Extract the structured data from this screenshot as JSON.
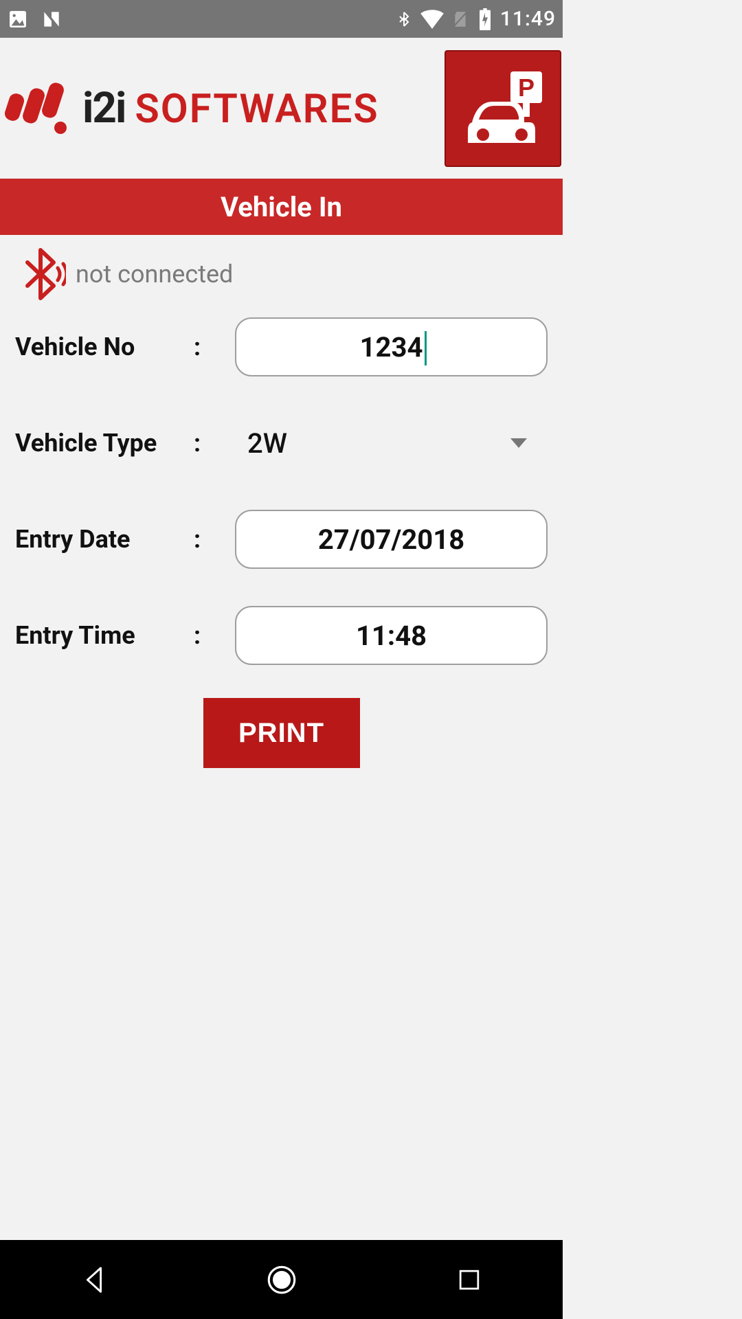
{
  "status_bar": {
    "time": "11:49"
  },
  "logo": {
    "i2i": "i2i",
    "softwares": "SOFTWARES"
  },
  "page_title": "Vehicle In",
  "bluetooth_status": "not connected",
  "form": {
    "vehicle_no": {
      "label": "Vehicle No",
      "value": "1234"
    },
    "vehicle_type": {
      "label": "Vehicle Type",
      "value": "2W"
    },
    "entry_date": {
      "label": "Entry Date",
      "value": "27/07/2018"
    },
    "entry_time": {
      "label": "Entry Time",
      "value": "11:48"
    }
  },
  "print_label": "PRINT"
}
